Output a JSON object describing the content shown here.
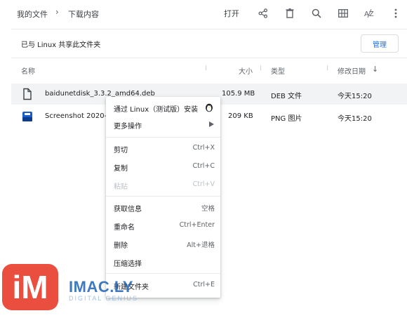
{
  "breadcrumb": {
    "root": "我的文件",
    "separator": "›",
    "current": "下载内容"
  },
  "toolbar": {
    "open_label": "打开",
    "icons": [
      "share-icon",
      "delete-icon",
      "search-icon",
      "grid-view-icon",
      "sort-az-icon",
      "more-vert-icon"
    ]
  },
  "share_bar": {
    "label": "已与 Linux 共享此文件夹",
    "manage_label": "管理"
  },
  "columns": {
    "name": "名称",
    "size": "大小",
    "type": "类型",
    "modified": "修改日期",
    "sort_arrow": "↓"
  },
  "files": [
    {
      "name": "baidunetdisk_3.3.2_amd64.deb",
      "size": "105.9 MB",
      "type": "DEB 文件",
      "modified": "今天15:20",
      "icon": "file-icon"
    },
    {
      "name": "Screenshot 2020-0",
      "size": "209 KB",
      "type": "PNG 图片",
      "modified": "今天15:20",
      "icon": "image-icon"
    }
  ],
  "context_menu": {
    "install": "通过 Linux（测试版）安装",
    "more_actions": "更多操作",
    "cut": "剪切",
    "cut_shortcut": "Ctrl+X",
    "copy": "复制",
    "copy_shortcut": "Ctrl+C",
    "paste": "粘贴",
    "paste_shortcut": "Ctrl+V",
    "get_info": "获取信息",
    "get_info_shortcut": "空格",
    "rename": "重命名",
    "rename_shortcut": "Ctrl+Enter",
    "delete": "删除",
    "delete_shortcut": "Alt+退格",
    "zip": "压缩选择",
    "new_folder": "新建文件夹",
    "new_folder_shortcut": "Ctrl+E"
  },
  "watermark": {
    "logo": "iM",
    "text": "IMAC.LY",
    "sub": "DIGITAL GENIUS"
  },
  "colors": {
    "accent": "#1a73e8",
    "selected_row": "#f1f3f4",
    "watermark_red": "#e8402f",
    "watermark_blue": "#1e63b6"
  }
}
